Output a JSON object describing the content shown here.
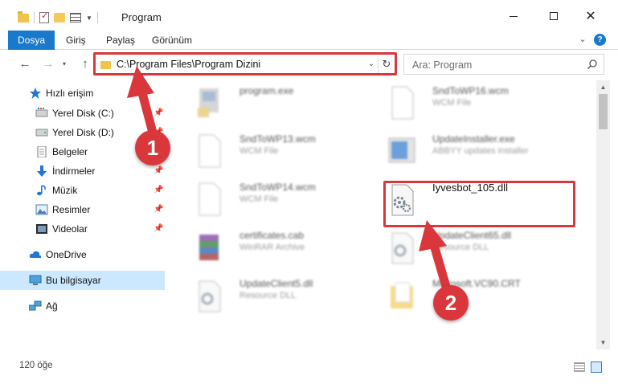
{
  "window": {
    "title": "Program"
  },
  "ribbon": {
    "tabs": [
      "Dosya",
      "Giriş",
      "Paylaş",
      "Görünüm"
    ]
  },
  "address_bar": {
    "path": "C:\\Program Files\\Program Dizini"
  },
  "search": {
    "placeholder": "Ara: Program"
  },
  "sidebar": {
    "items": [
      {
        "label": "Hızlı erişim",
        "icon": "star-icon",
        "pinned": false
      },
      {
        "label": "Yerel Disk (C:)",
        "icon": "drive-icon",
        "pinned": true
      },
      {
        "label": "Yerel Disk (D:)",
        "icon": "drive-icon",
        "pinned": true
      },
      {
        "label": "Belgeler",
        "icon": "documents-icon",
        "pinned": true
      },
      {
        "label": "İndirmeler",
        "icon": "download-icon",
        "pinned": true
      },
      {
        "label": "Müzik",
        "icon": "music-icon",
        "pinned": true
      },
      {
        "label": "Resimler",
        "icon": "pictures-icon",
        "pinned": true
      },
      {
        "label": "Videolar",
        "icon": "videos-icon",
        "pinned": true
      },
      {
        "label": "OneDrive",
        "icon": "cloud-icon",
        "pinned": false
      },
      {
        "label": "Bu bilgisayar",
        "icon": "computer-icon",
        "pinned": false,
        "selected": true
      },
      {
        "label": "Ağ",
        "icon": "network-icon",
        "pinned": false
      }
    ]
  },
  "files": [
    {
      "name": "program.exe",
      "type": "",
      "icon": "exe-icon"
    },
    {
      "name": "SndToWP16.wcm",
      "type": "WCM File",
      "icon": "file-icon"
    },
    {
      "name": "SndToWP13.wcm",
      "type": "WCM File",
      "icon": "file-icon"
    },
    {
      "name": "UpdateInstaller.exe",
      "type": "ABBYY updates installer",
      "icon": "installer-icon"
    },
    {
      "name": "SndToWP14.wcm",
      "type": "WCM File",
      "icon": "file-icon"
    },
    {
      "name": "Iyvesbot_105.dll",
      "type": "",
      "icon": "dll-icon"
    },
    {
      "name": "certificates.cab",
      "type": "WinRAR Archive",
      "icon": "winrar-icon"
    },
    {
      "name": "UpdateClient65.dll",
      "type": "Resource DLL",
      "icon": "dll-icon"
    },
    {
      "name": "UpdateClient5.dll",
      "type": "Resource DLL",
      "icon": "dll-icon"
    },
    {
      "name": "Microsoft.VC90.CRT",
      "type": "",
      "icon": "folder-icon"
    }
  ],
  "status": {
    "item_count": "120 öğe"
  },
  "annotations": {
    "step1": "1",
    "step2": "2",
    "color": "#d9373b"
  }
}
